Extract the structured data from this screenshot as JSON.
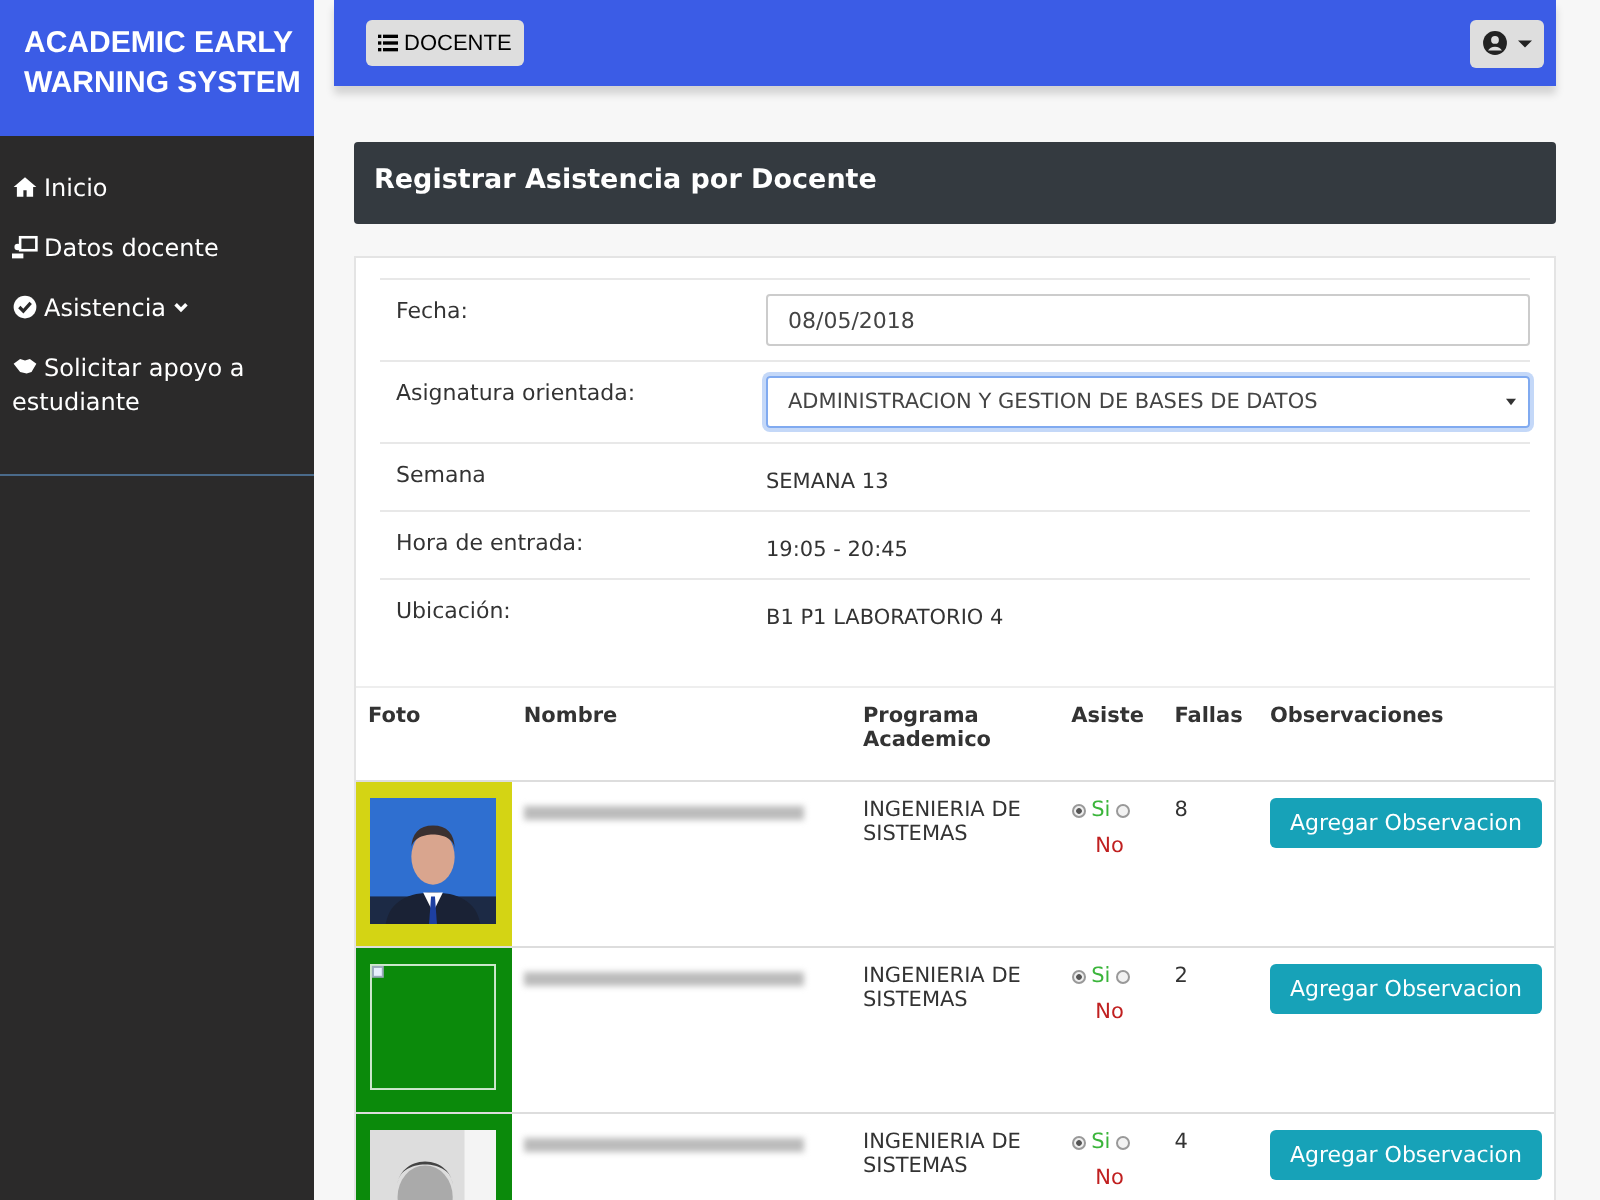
{
  "sidebar": {
    "brand": "ACADEMIC EARLY WARNING SYSTEM",
    "items": [
      {
        "label": "Inicio",
        "expandable": false
      },
      {
        "label": "Datos docente",
        "expandable": false
      },
      {
        "label": "Asistencia",
        "expandable": true
      },
      {
        "label": "Solicitar apoyo a estudiante",
        "expandable": false
      }
    ]
  },
  "topbar": {
    "menu_button": "DOCENTE"
  },
  "page_title": "Registrar Asistencia por Docente",
  "form": {
    "fields": [
      {
        "kind": "input",
        "label": "Fecha:",
        "value": "08/05/2018"
      },
      {
        "kind": "select",
        "label": "Asignatura orientada:",
        "value": "ADMINISTRACION Y GESTION DE BASES DE DATOS",
        "focused": true
      },
      {
        "kind": "text",
        "label": "Semana",
        "value": "SEMANA 13"
      },
      {
        "kind": "text",
        "label": "Hora de entrada:",
        "value": "19:05 - 20:45"
      },
      {
        "kind": "text",
        "label": "Ubicación:",
        "value": "B1 P1 LABORATORIO 4"
      }
    ]
  },
  "table": {
    "columns": [
      "Foto",
      "Nombre",
      "Programa Academico",
      "Asiste",
      "Fallas",
      "Observaciones"
    ],
    "rows": [
      {
        "color": "#d4d414",
        "kind": "picture",
        "program": "INGENIERIA DE SISTEMAS",
        "yes_label": "Si",
        "no_label": "No",
        "attends": true,
        "fallas": "8",
        "action": "Agregar Observacion"
      },
      {
        "color": "#0b8a0b",
        "kind": "broken",
        "program": "INGENIERIA DE SISTEMAS",
        "yes_label": "Si",
        "no_label": "No",
        "attends": true,
        "fallas": "2",
        "action": "Agregar Observacion"
      },
      {
        "color": "#0b8a0b",
        "kind": "picture",
        "program": "INGENIERIA DE SISTEMAS",
        "yes_label": "Si",
        "no_label": "No",
        "attends": true,
        "fallas": "4",
        "action": "Agregar Observacion"
      }
    ]
  }
}
